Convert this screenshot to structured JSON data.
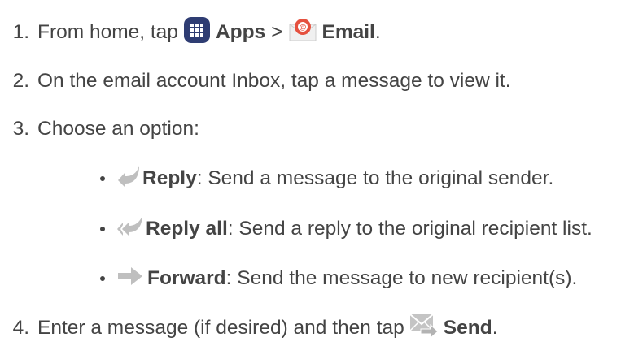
{
  "steps": [
    {
      "number": "1.",
      "prefix": "From home, tap",
      "apps_label": "Apps",
      "separator": ">",
      "email_label": "Email",
      "suffix": "."
    },
    {
      "number": "2.",
      "text": "On the email account Inbox, tap a message to view it."
    },
    {
      "number": "3.",
      "text": "Choose an option:"
    },
    {
      "number": "4.",
      "prefix": "Enter a message (if desired) and then tap",
      "send_label": "Send",
      "suffix": "."
    }
  ],
  "options": [
    {
      "label": "Reply",
      "desc": ": Send a message to the original sender.",
      "icon": "reply-icon"
    },
    {
      "label": "Reply all",
      "desc": ": Send a reply to the original recipient list.",
      "icon": "reply-all-icon"
    },
    {
      "label": "Forward",
      "desc": ": Send the message to new recipient(s).",
      "icon": "forward-icon"
    }
  ],
  "colors": {
    "text": "#444444",
    "apps_icon_bg": "#2f3d73",
    "email_icon": "#e5513f",
    "arrow_gray": "#bfbfbf"
  }
}
